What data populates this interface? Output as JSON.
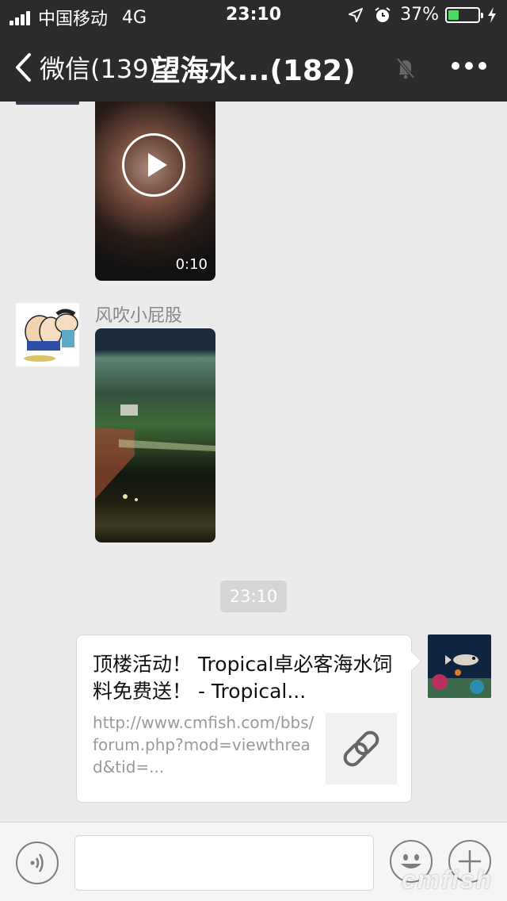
{
  "status_bar": {
    "carrier": "中国移动",
    "network": "4G",
    "time": "23:10",
    "battery_percent": "37%",
    "battery_level": 0.37,
    "battery_color": "#4cd964"
  },
  "nav": {
    "back_label": "微信(139)",
    "title": "望海水...(182)",
    "mute_icon": "bell-slash-icon",
    "more_icon": "ellipsis-icon"
  },
  "messages": {
    "video1": {
      "duration": "0:10"
    },
    "video2": {
      "sender": "风吹小屁股"
    },
    "timestamp": "23:10",
    "link": {
      "title": "顶楼活动！ Tropical卓必客海水饲料免费送！ - Tropical...",
      "url": "http://www.cmfish.com/bbs/forum.php?mod=viewthread&tid=...",
      "icon": "link-icon"
    }
  },
  "input_bar": {
    "voice_icon": "voice-icon",
    "emoji_icon": "emoji-icon",
    "plus_icon": "plus-icon",
    "input_value": ""
  },
  "watermark": "cmfish"
}
